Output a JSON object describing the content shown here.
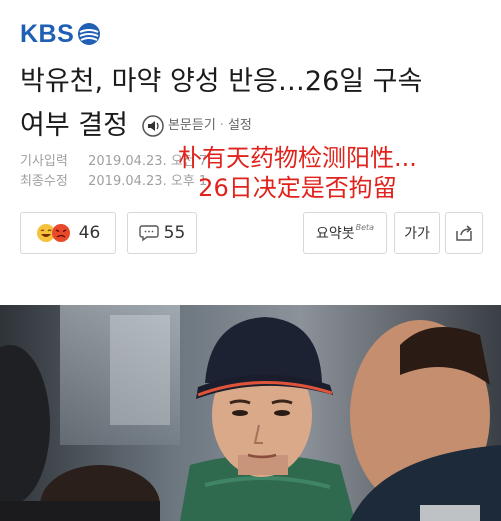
{
  "brand": {
    "name": "KBS",
    "color": "#1f5fb4"
  },
  "article": {
    "headline_line1": "박유천, 마약 양성 반응…26일 구속",
    "headline_line2": "여부 결정",
    "listen_label": "본문듣기",
    "listen_sep": "·",
    "settings_label": "설정",
    "published_label": "기사입력",
    "published_value": "2019.04.23. 오전 7",
    "updated_label": "최종수정",
    "updated_value": "2019.04.23. 오후 1"
  },
  "overlay": {
    "line1": "朴有天药物检测阳性...",
    "line2": "26日决定是否拘留",
    "color": "#e0231c"
  },
  "actions": {
    "reaction_count": "46",
    "comment_count": "55",
    "summary_label": "요약봇",
    "summary_badge": "Beta",
    "font_label": "가가",
    "share_icon": "share-icon"
  }
}
